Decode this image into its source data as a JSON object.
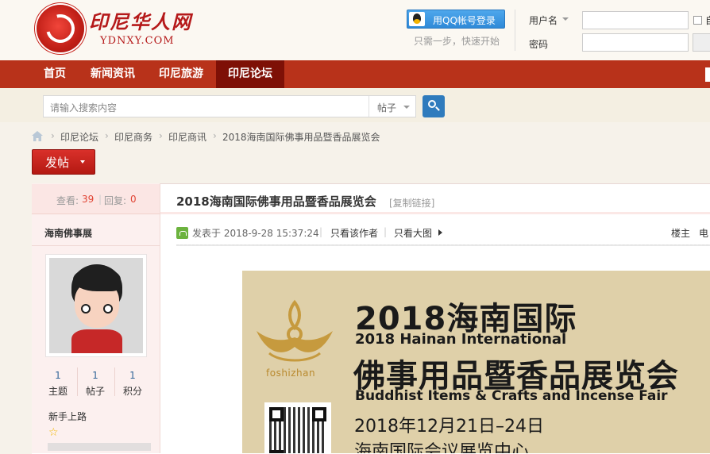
{
  "site": {
    "logo_cn": "印尼华人网",
    "logo_en": "YDNXY.COM"
  },
  "login": {
    "qq_button": "用QQ帐号登录",
    "qq_hint": "只需一步，快速开始",
    "username_label": "用户名",
    "password_label": "密码",
    "auto_login": "自"
  },
  "nav": {
    "items": [
      "首页",
      "新闻资讯",
      "印尼旅游",
      "印尼论坛"
    ],
    "active_index": 3,
    "bg_color": "#b8321a",
    "active_color": "#7e1006"
  },
  "search": {
    "placeholder": "请输入搜索内容",
    "type": "帖子"
  },
  "breadcrumb": [
    "印尼论坛",
    "印尼商务",
    "印尼商讯",
    "2018海南国际佛事用品暨香品展览会"
  ],
  "post_button": "发帖",
  "stats": {
    "views_label": "查看:",
    "views": "39",
    "replies_label": "回复:",
    "replies": "0"
  },
  "author": {
    "name": "海南佛事展",
    "stats": [
      {
        "value": "1",
        "label": "主题"
      },
      {
        "value": "1",
        "label": "帖子"
      },
      {
        "value": "1",
        "label": "积分"
      }
    ],
    "level": "新手上路"
  },
  "thread": {
    "title": "2018海南国际佛事用品暨香品展览会",
    "copy_link": "[复制链接]",
    "posted": "发表于 2018-9-28 15:37:24",
    "only_author": "只看该作者",
    "only_big_image": "只看大图",
    "floor": "楼主",
    "floor_next": "电"
  },
  "poster": {
    "brand": "foshizhan",
    "title_cn_1": "2018海南国际",
    "title_en_1": "2018 Hainan International",
    "title_cn_2": "佛事用品暨香品展览会",
    "title_en_2": "Buddhist Items & Crafts and Incense Fair",
    "date": "2018年12月21日–24日",
    "venue": "海南国际会议展览中心",
    "bg_color": "#dfd0a9"
  }
}
